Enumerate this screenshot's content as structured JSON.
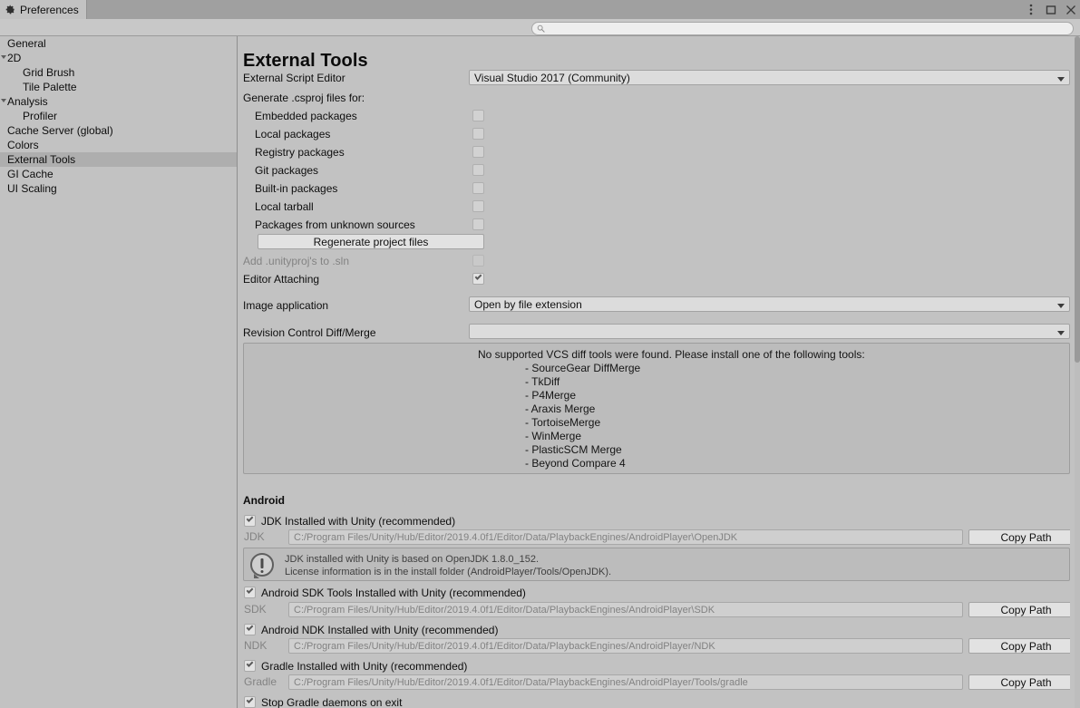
{
  "window": {
    "tab_title": "Preferences",
    "tab_icon": "gear-icon",
    "controls": {
      "menu": "kebab-menu-icon",
      "maximize": "maximize-icon",
      "close": "close-icon"
    }
  },
  "search": {
    "value": "",
    "placeholder": "",
    "icon": "search-icon"
  },
  "sidebar": {
    "items": [
      {
        "label": "General",
        "depth": 0,
        "foldout": false,
        "selected": false
      },
      {
        "label": "2D",
        "depth": 0,
        "foldout": true,
        "selected": false
      },
      {
        "label": "Grid Brush",
        "depth": 1,
        "foldout": false,
        "selected": false
      },
      {
        "label": "Tile Palette",
        "depth": 1,
        "foldout": false,
        "selected": false
      },
      {
        "label": "Analysis",
        "depth": 0,
        "foldout": true,
        "selected": false
      },
      {
        "label": "Profiler",
        "depth": 1,
        "foldout": false,
        "selected": false
      },
      {
        "label": "Cache Server (global)",
        "depth": 0,
        "foldout": false,
        "selected": false
      },
      {
        "label": "Colors",
        "depth": 0,
        "foldout": false,
        "selected": false
      },
      {
        "label": "External Tools",
        "depth": 0,
        "foldout": false,
        "selected": true
      },
      {
        "label": "GI Cache",
        "depth": 0,
        "foldout": false,
        "selected": false
      },
      {
        "label": "UI Scaling",
        "depth": 0,
        "foldout": false,
        "selected": false
      }
    ]
  },
  "main": {
    "title": "External Tools",
    "script_editor": {
      "label": "External Script Editor",
      "value": "Visual Studio 2017 (Community)"
    },
    "csproj": {
      "label": "Generate .csproj files for:",
      "options": [
        {
          "label": "Embedded packages",
          "checked": false
        },
        {
          "label": "Local packages",
          "checked": false
        },
        {
          "label": "Registry packages",
          "checked": false
        },
        {
          "label": "Git packages",
          "checked": false
        },
        {
          "label": "Built-in packages",
          "checked": false
        },
        {
          "label": "Local tarball",
          "checked": false
        },
        {
          "label": "Packages from unknown sources",
          "checked": false
        }
      ],
      "regenerate_button": "Regenerate project files"
    },
    "add_unityproj": {
      "label": "Add .unityproj's to .sln",
      "checked": false,
      "disabled": true
    },
    "editor_attaching": {
      "label": "Editor Attaching",
      "checked": true
    },
    "image_application": {
      "label": "Image application",
      "value": "Open by file extension"
    },
    "revision_control": {
      "label": "Revision Control Diff/Merge",
      "value": ""
    },
    "vcs_help": {
      "heading": "No supported VCS diff tools were found. Please install one of the following tools:",
      "tools": [
        "- SourceGear DiffMerge",
        "- TkDiff",
        "- P4Merge",
        "- Araxis Merge",
        "- TortoiseMerge",
        "- WinMerge",
        "- PlasticSCM Merge",
        "- Beyond Compare 4"
      ]
    },
    "android": {
      "heading": "Android",
      "jdk": {
        "toggle_label": "JDK Installed with Unity (recommended)",
        "toggle_checked": true,
        "path_label": "JDK",
        "path_value": "C:/Program Files/Unity/Hub/Editor/2019.4.0f1/Editor/Data/PlaybackEngines/AndroidPlayer\\OpenJDK",
        "copy_button": "Copy Path",
        "info_line1": "JDK installed with Unity is based on OpenJDK 1.8.0_152.",
        "info_line2": "License information is in the install folder (AndroidPlayer/Tools/OpenJDK).",
        "info_icon": "warning-bubble-icon"
      },
      "sdk": {
        "toggle_label": "Android SDK Tools Installed with Unity (recommended)",
        "toggle_checked": true,
        "path_label": "SDK",
        "path_value": "C:/Program Files/Unity/Hub/Editor/2019.4.0f1/Editor/Data/PlaybackEngines/AndroidPlayer\\SDK",
        "copy_button": "Copy Path"
      },
      "ndk": {
        "toggle_label": "Android NDK Installed with Unity (recommended)",
        "toggle_checked": true,
        "path_label": "NDK",
        "path_value": "C:/Program Files/Unity/Hub/Editor/2019.4.0f1/Editor/Data/PlaybackEngines/AndroidPlayer/NDK",
        "copy_button": "Copy Path"
      },
      "gradle": {
        "toggle_label": "Gradle Installed with Unity (recommended)",
        "toggle_checked": true,
        "path_label": "Gradle",
        "path_value": "C:/Program Files/Unity/Hub/Editor/2019.4.0f1/Editor/Data/PlaybackEngines/AndroidPlayer/Tools/gradle",
        "copy_button": "Copy Path"
      },
      "stop_gradle": {
        "label": "Stop Gradle daemons on exit",
        "checked": true
      }
    }
  },
  "colors": {
    "window_bg": "#c2c2c2",
    "tabbar_bg": "#a0a0a0",
    "selection": "#aeaeae",
    "field_bg": "#dcdcdc",
    "helpbox_bg": "#bcbcbc",
    "disabled_text": "#838383"
  }
}
